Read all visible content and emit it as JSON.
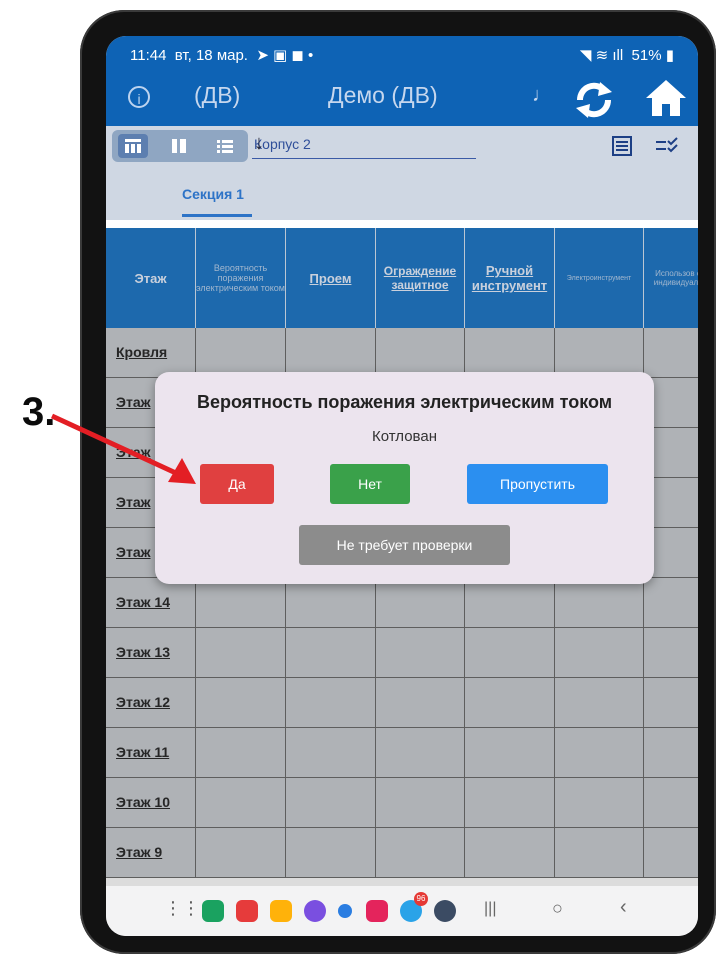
{
  "annotation": {
    "step": "3."
  },
  "status": {
    "time": "11:44",
    "date": "вт, 18 мар.",
    "battery": "51%"
  },
  "header": {
    "left_title": "(ДВ)",
    "center_title": "Демо (ДВ)",
    "note": "♩"
  },
  "toolbar": {
    "building": "Корпус 2",
    "arrow": "↓"
  },
  "tabs": [
    {
      "label": "Секция 1"
    }
  ],
  "table": {
    "headers": [
      "Этаж",
      "Вероятность поражения электрическим током",
      "Проем",
      "Ограждение защитное",
      "Ручной инструмент",
      "Электроинструмент",
      "Использов средст индивидуал защит"
    ],
    "rows": [
      "Кровля",
      "Этаж",
      "Этаж",
      "Этаж",
      "Этаж",
      "Этаж 14",
      "Этаж 13",
      "Этаж 12",
      "Этаж 11",
      "Этаж 10",
      "Этаж 9"
    ]
  },
  "dialog": {
    "title": "Вероятность поражения электрическим током",
    "subtitle": "Котлован",
    "yes": "Да",
    "no": "Нет",
    "skip": "Пропустить",
    "not_required": "Не требует проверки"
  },
  "colors": {
    "appbar": "#0e63b5",
    "header": "#1673c6",
    "yes": "#e04040",
    "no": "#3aa14a",
    "skip": "#2b8ff0",
    "not_required": "#8c8c8c",
    "arrow": "#e31e24"
  },
  "dock": {
    "badge": "96",
    "icons": [
      "apps-icon",
      "green-app-icon",
      "red-app-icon",
      "folder-icon",
      "purple-app-icon",
      "chat-icon",
      "camera-icon",
      "telegram-icon",
      "settings-icon",
      "recents-icon",
      "home-icon",
      "back-icon"
    ]
  }
}
